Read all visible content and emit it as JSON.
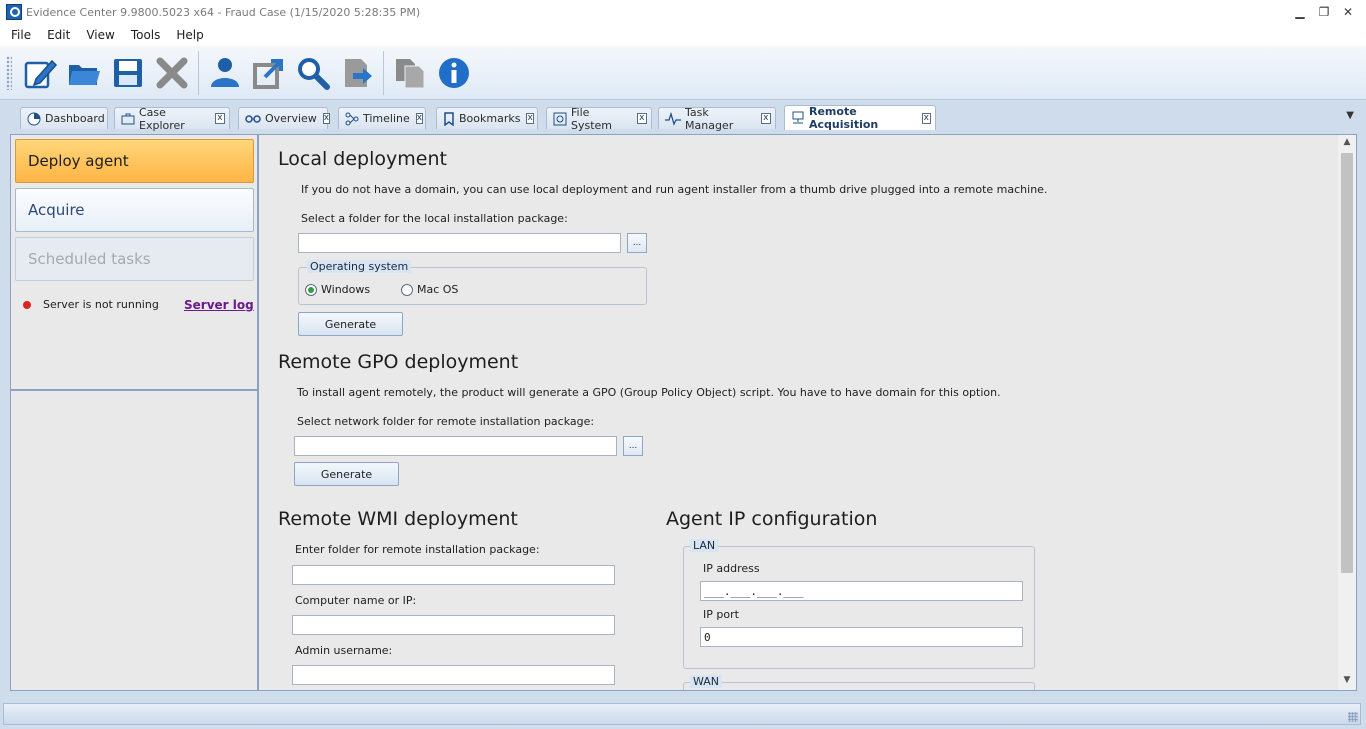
{
  "window": {
    "title": "Evidence Center 9.9800.5023 x64 - Fraud Case (1/15/2020 5:28:35 PM)",
    "minimize": "▁",
    "restore": "❐",
    "close": "✕"
  },
  "menu": [
    "File",
    "Edit",
    "View",
    "Tools",
    "Help"
  ],
  "toolbar": {
    "icons": [
      "edit-icon",
      "open-folder-icon",
      "save-icon",
      "delete-icon",
      "user-icon",
      "export-icon",
      "search-icon",
      "forward-icon",
      "copy-icon",
      "info-icon"
    ]
  },
  "tabs": [
    {
      "label": "Dashboard",
      "icon": "pie-chart-icon",
      "closable": false
    },
    {
      "label": "Case Explorer",
      "icon": "case-icon",
      "closable": true
    },
    {
      "label": "Overview",
      "icon": "glasses-icon",
      "closable": true
    },
    {
      "label": "Timeline",
      "icon": "timeline-icon",
      "closable": true
    },
    {
      "label": "Bookmarks",
      "icon": "bookmark-icon",
      "closable": true
    },
    {
      "label": "File System",
      "icon": "file-system-icon",
      "closable": true
    },
    {
      "label": "Task Manager",
      "icon": "pulse-icon",
      "closable": true
    },
    {
      "label": "Remote Acquisition",
      "icon": "network-icon",
      "closable": true,
      "active": true
    }
  ],
  "tab_close_glyph": "x",
  "tab_dropdown_glyph": "▼",
  "left_nav": {
    "deploy": "Deploy agent",
    "acquire": "Acquire",
    "scheduled": "Scheduled tasks",
    "server_status": "Server is not running",
    "server_log": "Server log",
    "status_color": "#e02424"
  },
  "local": {
    "title": "Local deployment",
    "desc": "If you do not have a domain, you can use local deployment and run agent installer from a thumb drive plugged into a remote machine.",
    "folder_label": "Select a folder for the local installation package:",
    "folder_value": "",
    "browse": "...",
    "os_legend": "Operating system",
    "os_windows": "Windows",
    "os_mac": "Mac OS",
    "generate": "Generate"
  },
  "gpo": {
    "title": "Remote GPO deployment",
    "desc": "To install agent remotely, the product will generate a GPO (Group Policy Object) script. You have to have domain for this option.",
    "folder_label": "Select network folder for remote installation package:",
    "folder_value": "",
    "browse": "...",
    "generate": "Generate"
  },
  "wmi": {
    "title": "Remote WMI deployment",
    "folder_label": "Enter folder for remote installation package:",
    "folder_value": "",
    "computer_label": "Computer name or IP:",
    "computer_value": "",
    "admin_label": "Admin username:",
    "admin_value": ""
  },
  "agent_ip": {
    "title": "Agent IP configuration",
    "lan_legend": "LAN",
    "ip_label": "IP address",
    "ip_value": "___.___.___.___",
    "port_label": "IP port",
    "port_value": "0",
    "wan_legend": "WAN"
  },
  "scroll": {
    "up": "▲",
    "down": "▼"
  }
}
